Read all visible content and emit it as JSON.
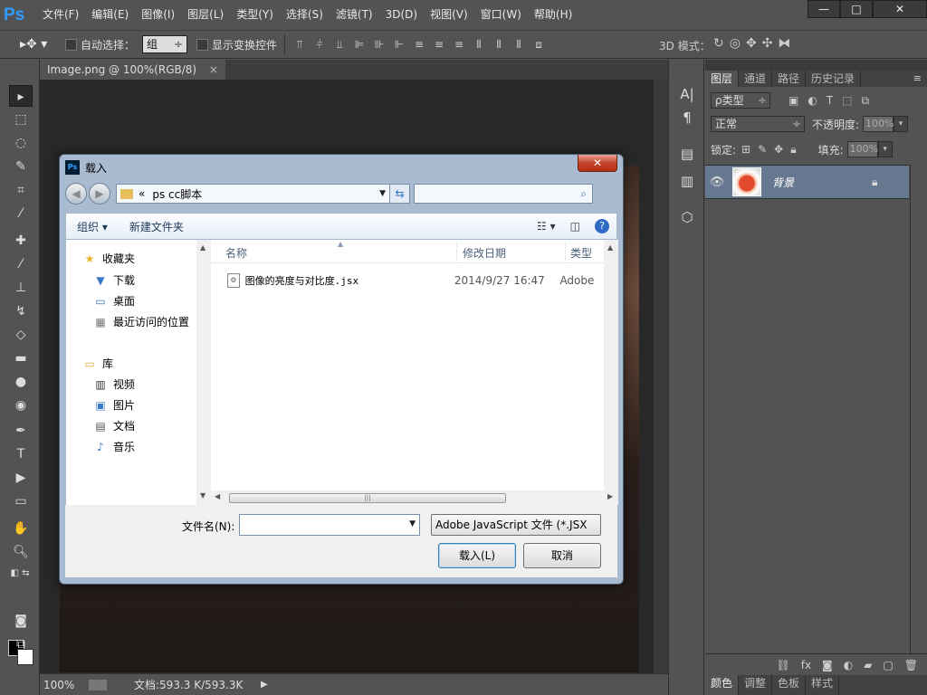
{
  "app": {
    "logo": "Ps",
    "menu": [
      "文件(F)",
      "编辑(E)",
      "图像(I)",
      "图层(L)",
      "类型(Y)",
      "选择(S)",
      "滤镜(T)",
      "3D(D)",
      "视图(V)",
      "窗口(W)",
      "帮助(H)"
    ],
    "window_controls": {
      "minimize": "—",
      "maximize": "□",
      "close": "✕"
    }
  },
  "options_bar": {
    "tool_icon": "move-tool-icon",
    "auto_select_label": "自动选择：",
    "auto_select_value": "组",
    "show_transform_label": "显示变换控件",
    "mode_3d_label": "3D 模式："
  },
  "document": {
    "tab_title": "Image.png @ 100%(RGB/8)",
    "tab_close": "×",
    "zoom": "100%",
    "doc_info": "文档:593.3 K/593.3K"
  },
  "layers_panel": {
    "tabs": [
      "图层",
      "通道",
      "路径",
      "历史记录"
    ],
    "filter_label": "ρ类型",
    "blend_mode": "正常",
    "opacity_label": "不透明度:",
    "opacity_value": "100%",
    "lock_label": "锁定:",
    "fill_label": "填充:",
    "fill_value": "100%",
    "layer_name": "背景"
  },
  "color_tabs": [
    "颜色",
    "调整",
    "色板",
    "样式"
  ],
  "dialog": {
    "title": "载入",
    "close_label": "✕",
    "address_prefix": "«",
    "address_folder": "ps cc脚本",
    "search_placeholder": "",
    "organize_label": "组织 ▾",
    "new_folder_label": "新建文件夹",
    "nav": {
      "favorites": "收藏夹",
      "downloads": "下载",
      "desktop": "桌面",
      "recent": "最近访问的位置",
      "libraries": "库",
      "videos": "视频",
      "pictures": "图片",
      "documents": "文档",
      "music": "音乐"
    },
    "columns": {
      "name": "名称",
      "date": "修改日期",
      "type": "类型"
    },
    "files": [
      {
        "name": "图像的亮度与对比度.jsx",
        "date": "2014/9/27 16:47",
        "type": "Adobe"
      }
    ],
    "filename_label": "文件名(N):",
    "filename_value": "",
    "filetype_value": "Adobe JavaScript 文件 (*.JSX",
    "open_label": "载入(L)",
    "cancel_label": "取消"
  }
}
